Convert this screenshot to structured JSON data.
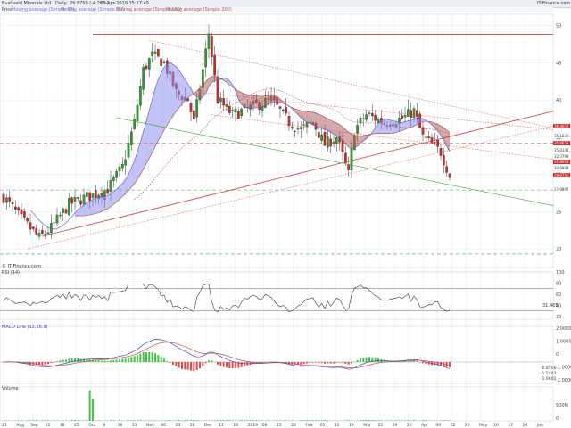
{
  "header": {
    "instrument": "Bushveld Minerals Ltd",
    "period": "Daily",
    "last_change": "29.8750 (-4.20%)",
    "datetime": "15-Apr-2019 15:27:45",
    "brand": "IT-Finance.com"
  },
  "legend": {
    "price_label": "Price",
    "items": [
      "Moving average (Simple 50)",
      "Moving average (Simple 100)",
      "Moving average (Simple 200)"
    ],
    "ma_extra": "Moving average (Simple 1.2)"
  },
  "colors": {
    "up": "#2e9c2e",
    "down": "#cc2a2a",
    "cloud_blue": "#8f8ff0",
    "cloud_red": "#b06060",
    "resistance": "#d43a3a",
    "support": "#39a839",
    "grid": "#e4e8ee",
    "macd_pos": "#3fc63f",
    "macd_neg": "#e24a4a",
    "volume": "#3fc63f"
  },
  "chart_data": [
    {
      "type": "candlestick",
      "panel": "price",
      "y_ticks": [
        20,
        25,
        30,
        35,
        40,
        45,
        50
      ],
      "ylim": [
        17.5,
        51.5
      ],
      "x_labels": [
        "21",
        "Aug",
        "Sep",
        "11",
        "18",
        "25",
        "Oct",
        "9",
        "16",
        "23",
        "Nov",
        "06",
        "13",
        "20",
        "Dec",
        "11",
        "18",
        "2019",
        "08",
        "15",
        "22",
        "Feb",
        "05",
        "12",
        "19",
        "Mar",
        "12",
        "19",
        "26",
        "Apr",
        "09",
        "12",
        "26",
        "May",
        "10",
        "17",
        "24",
        "Jun"
      ],
      "price_labels": [
        {
          "value": "36.4657",
          "y": 36.47,
          "color": "#cc2a2a"
        },
        {
          "value": "36.1630",
          "y": 35.2,
          "color": "#ffffff"
        },
        {
          "value": "35.8653",
          "y": 34.2,
          "color": "#cc2a2a"
        },
        {
          "value": "35.0141",
          "y": 33.3,
          "color": "#ffffff"
        },
        {
          "value": "32.3798",
          "y": 32.4,
          "color": "#ffffff"
        },
        {
          "value": "31.8653",
          "y": 31.7,
          "color": "#cc2a2a"
        },
        {
          "value": "30.9804",
          "y": 30.9,
          "color": "#ffffff"
        },
        {
          "value": "29.8750",
          "y": 29.88,
          "color": "#cc2a2a"
        },
        {
          "value": "27.9897",
          "y": 27.99,
          "color": "#ffffff"
        }
      ],
      "last": 29.875,
      "horizontal_levels": [
        {
          "value": 48.8,
          "style": "solid",
          "color": "#d43a3a"
        },
        {
          "value": 34.2,
          "style": "dashed",
          "color": "#d43a3a"
        },
        {
          "value": 27.9,
          "style": "dashed",
          "color": "#39a839"
        },
        {
          "value": 19.3,
          "style": "dashed",
          "color": "#39a839"
        }
      ],
      "watermark": "© IT-Finance.com"
    },
    {
      "type": "line",
      "panel": "rsi",
      "title": "RSI (14)",
      "y_ticks": [
        20,
        40,
        60,
        80,
        100
      ],
      "levels": [
        30,
        70
      ],
      "last_label": "31.465",
      "ylim": [
        15,
        100
      ]
    },
    {
      "type": "bar",
      "panel": "macd",
      "title": "MACD Line (12,26,9)",
      "y_ticks": [
        "2.0000",
        "1.0000",
        "0",
        "-1.0000",
        "-2.0000"
      ],
      "last_labels": [
        "-0.8556",
        "-1.5403",
        "-1.9002"
      ]
    },
    {
      "type": "bar",
      "panel": "volume",
      "title": "Volume",
      "y_ticks": [
        "500M",
        "0"
      ]
    }
  ]
}
